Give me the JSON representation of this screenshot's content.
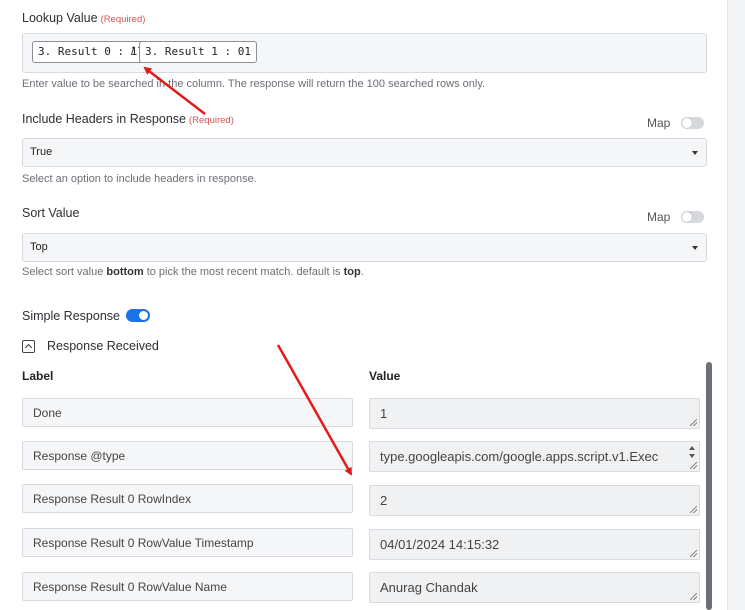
{
  "lookup": {
    "label": "Lookup Value",
    "required": "(Required)",
    "chips": [
      "3. Result 0 : 17",
      "3. Result 1 : 01"
    ],
    "separator": "/",
    "help": "Enter value to be searched in the column. The response will return the 100 searched rows only."
  },
  "headers": {
    "label": "Include Headers in Response",
    "required": "(Required)",
    "map_label": "Map",
    "value": "True",
    "help": "Select an option to include headers in response."
  },
  "sort": {
    "label": "Sort Value",
    "map_label": "Map",
    "value": "Top",
    "help_prefix": "Select sort value ",
    "help_bold1": "bottom",
    "help_middle": " to pick the most recent match. default is ",
    "help_bold2": "top",
    "help_suffix": "."
  },
  "simple_response": {
    "label": "Simple Response",
    "enabled": true
  },
  "response_received": {
    "label": "Response Received",
    "col_label": "Label",
    "col_value": "Value",
    "rows": [
      {
        "label": "Done",
        "value": "1"
      },
      {
        "label": "Response @type",
        "value": "type.googleapis.com/google.apps.script.v1.Exec"
      },
      {
        "label": "Response Result 0 RowIndex",
        "value": "2"
      },
      {
        "label": "Response Result 0 RowValue Timestamp",
        "value": "04/01/2024 14:15:32"
      },
      {
        "label": "Response Result 0 RowValue Name",
        "value": "Anurag Chandak"
      }
    ]
  },
  "colors": {
    "accent": "#1a73e8",
    "required": "#d9534f",
    "annotation_arrow": "#e31b1b"
  }
}
